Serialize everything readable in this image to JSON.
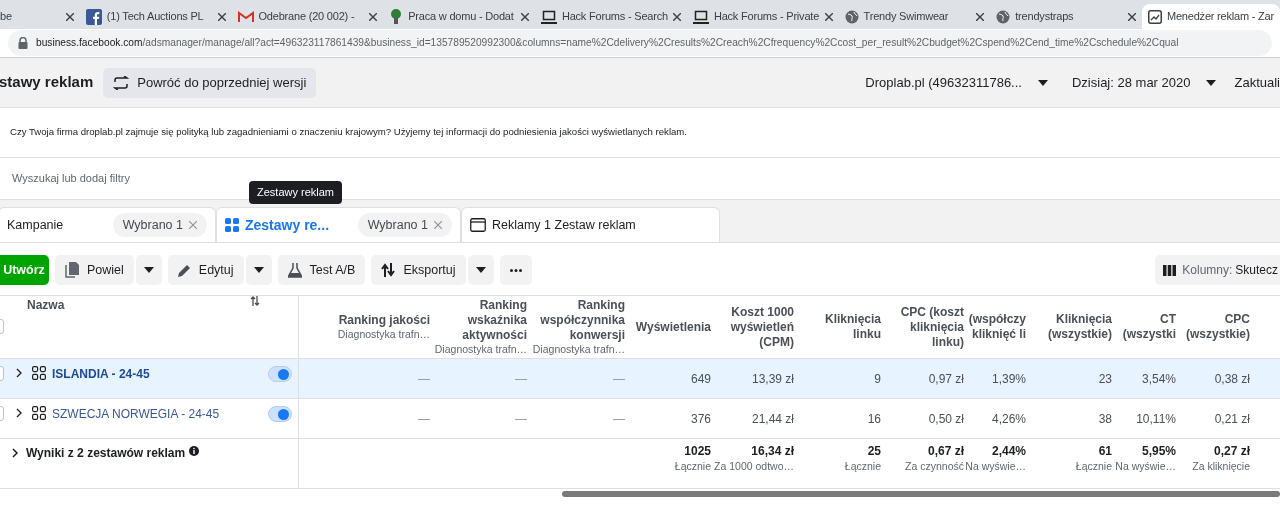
{
  "browser": {
    "tabs": [
      {
        "title": "be",
        "kind": "plain",
        "selected": false
      },
      {
        "title": "(1) Tech Auctions PL",
        "kind": "social",
        "selected": false
      },
      {
        "title": "Odebrane (20 002) -",
        "kind": "mail",
        "selected": false
      },
      {
        "title": "Praca w domu - Dodat",
        "kind": "tree",
        "selected": false
      },
      {
        "title": "Hack Forums - Search",
        "kind": "laptop",
        "selected": false
      },
      {
        "title": "Hack Forums - Private",
        "kind": "laptop",
        "selected": false
      },
      {
        "title": "Trendy Swimwear",
        "kind": "globe",
        "selected": false
      },
      {
        "title": "trendystraps",
        "kind": "globe",
        "selected": false
      },
      {
        "title": "Menedżer reklam - Zar",
        "kind": "ads",
        "selected": true
      }
    ],
    "url": {
      "host": "business.facebook.com",
      "path": "/adsmanager/manage/all?act=496323117861439&business_id=135789520992300&columns=name%2Cdelivery%2Cresults%2Creach%2Cfrequency%2Ccost_per_result%2Cbudget%2Cspend%2Cend_time%2Cschedule%2Cqual"
    }
  },
  "header": {
    "title": "stawy reklam",
    "revert_button": "Powróć do poprzedniej wersji",
    "account": "Droplab.pl (49632311786...",
    "date": "Dzisiaj: 28 mar 2020",
    "update": "Zaktuali"
  },
  "notice": "Czy Twoja firma droplab.pl zajmuje się polityką lub zagadnieniami o znaczeniu krajowym? Użyjemy tej informacji do podniesienia jakości wyświetlanych reklam.",
  "filter": {
    "placeholder": "Wyszukaj lub dodaj filtry"
  },
  "tooltip": "Zestawy reklam",
  "level_tabs": [
    {
      "label": "Kampanie",
      "chip": "Wybrano 1",
      "selected": false
    },
    {
      "label": "Zestawy re...",
      "chip": "Wybrano 1",
      "selected": true
    },
    {
      "label": "Reklamy 1 Zestaw reklam",
      "selected": false
    }
  ],
  "toolbar": {
    "create": "Utwórz",
    "buttons": [
      {
        "label": "Powiel",
        "kind": "copy",
        "dropdown": true
      },
      {
        "label": "Edytuj",
        "kind": "edit",
        "dropdown": true
      },
      {
        "label": "Test A/B",
        "kind": "test",
        "dropdown": false
      },
      {
        "label": "Eksportuj",
        "kind": "export",
        "dropdown": true
      }
    ],
    "columns_label": "Kolumny:",
    "columns_value": "Skutecz"
  },
  "table": {
    "name_column": "Nazwa",
    "all_checked": false,
    "columns": [
      {
        "title": "Ranking jakości",
        "subtitle": "Diagnostyka trafn…"
      },
      {
        "title": "Ranking wskaźnika aktywności",
        "subtitle": "Diagnostyka trafn…"
      },
      {
        "title": "Ranking współczynnika konwersji",
        "subtitle": "Diagnostyka trafn…"
      },
      {
        "title": "Wyświetlenia"
      },
      {
        "title": "Koszt 1000 wyświetleń (CPM)"
      },
      {
        "title": "Kliknięcia linku"
      },
      {
        "title": "CPC (koszt kliknięcia linku)"
      },
      {
        "title": "(współczy kliknięć li"
      },
      {
        "title": "Kliknięcia (wszystkie)"
      },
      {
        "title": "CT (wszystki"
      },
      {
        "title": "CPC (wszystkie)"
      }
    ],
    "rows": [
      {
        "name": "ISLANDIA - 24-45",
        "selected": true,
        "checked": false,
        "on": true,
        "values": [
          "—",
          "—",
          "—",
          "649",
          "13,39 zł",
          "9",
          "0,97 zł",
          "1,39%",
          "23",
          "3,54%",
          "0,38 zł"
        ]
      },
      {
        "name": "SZWECJA NORWEGIA - 24-45",
        "selected": false,
        "checked": false,
        "on": true,
        "values": [
          "—",
          "—",
          "—",
          "376",
          "21,44 zł",
          "16",
          "0,50 zł",
          "4,26%",
          "38",
          "10,11%",
          "0,21 zł"
        ]
      }
    ],
    "totals": {
      "label": "Wyniki z 2 zestawów reklam",
      "values": [
        {
          "value": "1025",
          "note": "Łącznie"
        },
        {
          "value": "16,34 zł",
          "note": "Za 1000 odtwo…"
        },
        {
          "value": "25",
          "note": "Łącznie"
        },
        {
          "value": "0,67 zł",
          "note": "Za czynność"
        },
        {
          "value": "2,44%",
          "note": "Na wyświe…"
        },
        {
          "value": "61",
          "note": "Łącznie"
        },
        {
          "value": "5,95%",
          "note": "Na wyświe…"
        },
        {
          "value": "0,27 zł",
          "note": "Za kliknięcie"
        }
      ]
    }
  }
}
